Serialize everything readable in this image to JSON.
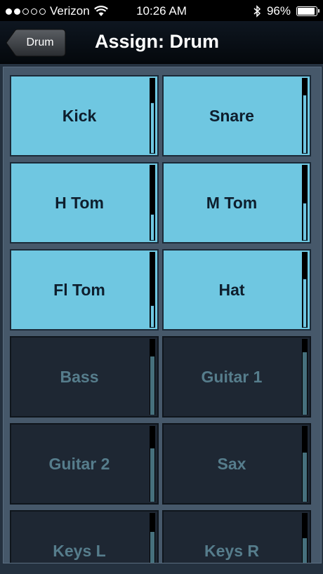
{
  "status_bar": {
    "carrier": "Verizon",
    "signal_bars_filled": 2,
    "signal_bars_total": 5,
    "time": "10:26 AM",
    "battery_percent": "96%",
    "battery_level": 0.96
  },
  "nav": {
    "back_label": "Drum",
    "title": "Assign: Drum"
  },
  "channels": [
    {
      "name": "Kick",
      "assigned": true,
      "meter_level": 0.68
    },
    {
      "name": "Snare",
      "assigned": true,
      "meter_level": 0.78
    },
    {
      "name": "H Tom",
      "assigned": true,
      "meter_level": 0.35
    },
    {
      "name": "M Tom",
      "assigned": true,
      "meter_level": 0.5
    },
    {
      "name": "Fl Tom",
      "assigned": true,
      "meter_level": 0.3
    },
    {
      "name": "Hat",
      "assigned": true,
      "meter_level": 0.65
    },
    {
      "name": "Bass",
      "assigned": false,
      "meter_level": 0.77
    },
    {
      "name": "Guitar 1",
      "assigned": false,
      "meter_level": 0.82
    },
    {
      "name": "Guitar 2",
      "assigned": false,
      "meter_level": 0.7
    },
    {
      "name": "Sax",
      "assigned": false,
      "meter_level": 0.65
    },
    {
      "name": "Keys L",
      "assigned": false,
      "meter_level": 0.75
    },
    {
      "name": "Keys R",
      "assigned": false,
      "meter_level": 0.67
    }
  ]
}
